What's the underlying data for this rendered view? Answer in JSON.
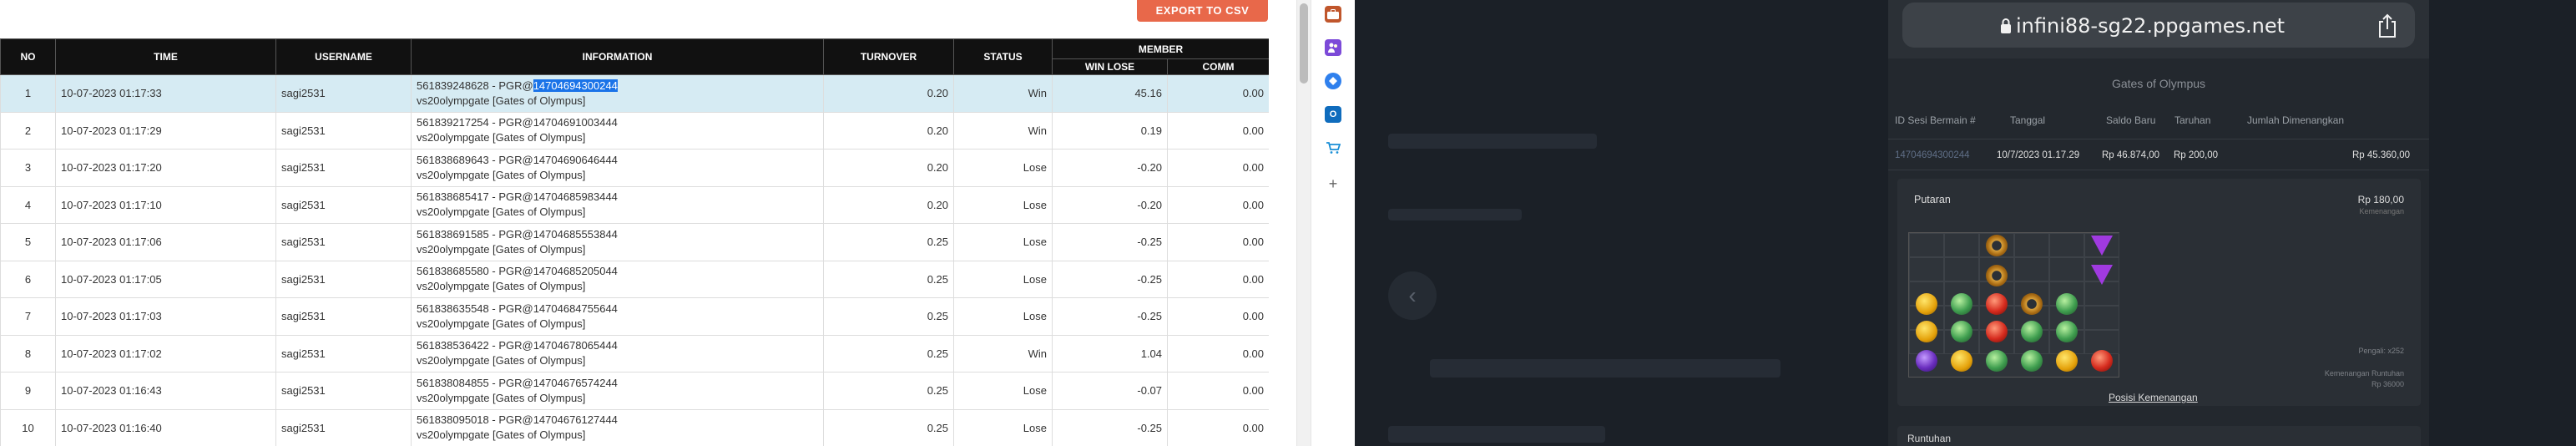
{
  "report": {
    "export_label": "EXPORT TO CSV",
    "headers": {
      "no": "NO",
      "time": "TIME",
      "username": "USERNAME",
      "information": "INFORMATION",
      "turnover": "TURNOVER",
      "status": "STATUS",
      "member": "MEMBER",
      "win_lose": "WIN LOSE",
      "comm": "COMM"
    },
    "rows": [
      {
        "no": "1",
        "time": "10-07-2023 01:17:33",
        "user": "sagi2531",
        "info_prefix": "561839248628 - PGR@",
        "info_id": "14704694300244",
        "info_game": "vs20olympgate [Gates of Olympus]",
        "turnover": "0.20",
        "status": "Win",
        "winlose": "45.16",
        "comm": "0.00"
      },
      {
        "no": "2",
        "time": "10-07-2023 01:17:29",
        "user": "sagi2531",
        "info_prefix": "561839217254 - PGR@",
        "info_id": "14704691003444",
        "info_game": "vs20olympgate [Gates of Olympus]",
        "turnover": "0.20",
        "status": "Win",
        "winlose": "0.19",
        "comm": "0.00"
      },
      {
        "no": "3",
        "time": "10-07-2023 01:17:20",
        "user": "sagi2531",
        "info_prefix": "561838689643 - PGR@",
        "info_id": "14704690646444",
        "info_game": "vs20olympgate [Gates of Olympus]",
        "turnover": "0.20",
        "status": "Lose",
        "winlose": "-0.20",
        "comm": "0.00"
      },
      {
        "no": "4",
        "time": "10-07-2023 01:17:10",
        "user": "sagi2531",
        "info_prefix": "561838685417 - PGR@",
        "info_id": "14704685983444",
        "info_game": "vs20olympgate [Gates of Olympus]",
        "turnover": "0.20",
        "status": "Lose",
        "winlose": "-0.20",
        "comm": "0.00"
      },
      {
        "no": "5",
        "time": "10-07-2023 01:17:06",
        "user": "sagi2531",
        "info_prefix": "561838691585 - PGR@",
        "info_id": "14704685553844",
        "info_game": "vs20olympgate [Gates of Olympus]",
        "turnover": "0.25",
        "status": "Lose",
        "winlose": "-0.25",
        "comm": "0.00"
      },
      {
        "no": "6",
        "time": "10-07-2023 01:17:05",
        "user": "sagi2531",
        "info_prefix": "561838685580 - PGR@",
        "info_id": "14704685205044",
        "info_game": "vs20olympgate [Gates of Olympus]",
        "turnover": "0.25",
        "status": "Lose",
        "winlose": "-0.25",
        "comm": "0.00"
      },
      {
        "no": "7",
        "time": "10-07-2023 01:17:03",
        "user": "sagi2531",
        "info_prefix": "561838635548 - PGR@",
        "info_id": "14704684755644",
        "info_game": "vs20olympgate [Gates of Olympus]",
        "turnover": "0.25",
        "status": "Lose",
        "winlose": "-0.25",
        "comm": "0.00"
      },
      {
        "no": "8",
        "time": "10-07-2023 01:17:02",
        "user": "sagi2531",
        "info_prefix": "561838536422 - PGR@",
        "info_id": "14704678065444",
        "info_game": "vs20olympgate [Gates of Olympus]",
        "turnover": "0.25",
        "status": "Win",
        "winlose": "1.04",
        "comm": "0.00"
      },
      {
        "no": "9",
        "time": "10-07-2023 01:16:43",
        "user": "sagi2531",
        "info_prefix": "561838084855 - PGR@",
        "info_id": "14704676574244",
        "info_game": "vs20olympgate [Gates of Olympus]",
        "turnover": "0.25",
        "status": "Lose",
        "winlose": "-0.07",
        "comm": "0.00"
      },
      {
        "no": "10",
        "time": "10-07-2023 01:16:40",
        "user": "sagi2531",
        "info_prefix": "561838095018 - PGR@",
        "info_id": "14704676127444",
        "info_game": "vs20olympgate [Gates of Olympus]",
        "turnover": "0.25",
        "status": "Lose",
        "winlose": "-0.25",
        "comm": "0.00"
      }
    ]
  },
  "extensions": [
    "briefcase-icon",
    "people-icon",
    "copilot-icon",
    "outlook-icon",
    "shopping-icon",
    "add-icon"
  ],
  "phone": {
    "url": "infini88-sg22.ppgames.net",
    "game_title": "Gates of Olympus",
    "columns": [
      "ID Sesi Bermain #",
      "Tanggal",
      "Saldo Baru",
      "Taruhan",
      "Jumlah Dimenangkan"
    ],
    "session": {
      "id": "14704694300244",
      "date": "10/7/2023 01.17.29",
      "balance": "Rp 46.874,00",
      "bet": "Rp 200,00",
      "won": "Rp 45.360,00"
    },
    "putaran_label": "Putaran",
    "spin_win": "Rp 180,00",
    "spin_win_label": "Kemenangan",
    "multiplier_label": "Pengali: x252",
    "total_win_label": "Kemenangan Runtuhan",
    "total_win_value": "Rp 36000",
    "posisi_label": "Posisi Kemenangan",
    "runtuhan_label": "Runtuhan"
  },
  "colors": {
    "win": "#3aa13a",
    "lose": "#e53935",
    "export": "#e8684a",
    "highlight": "#1a73e8"
  }
}
